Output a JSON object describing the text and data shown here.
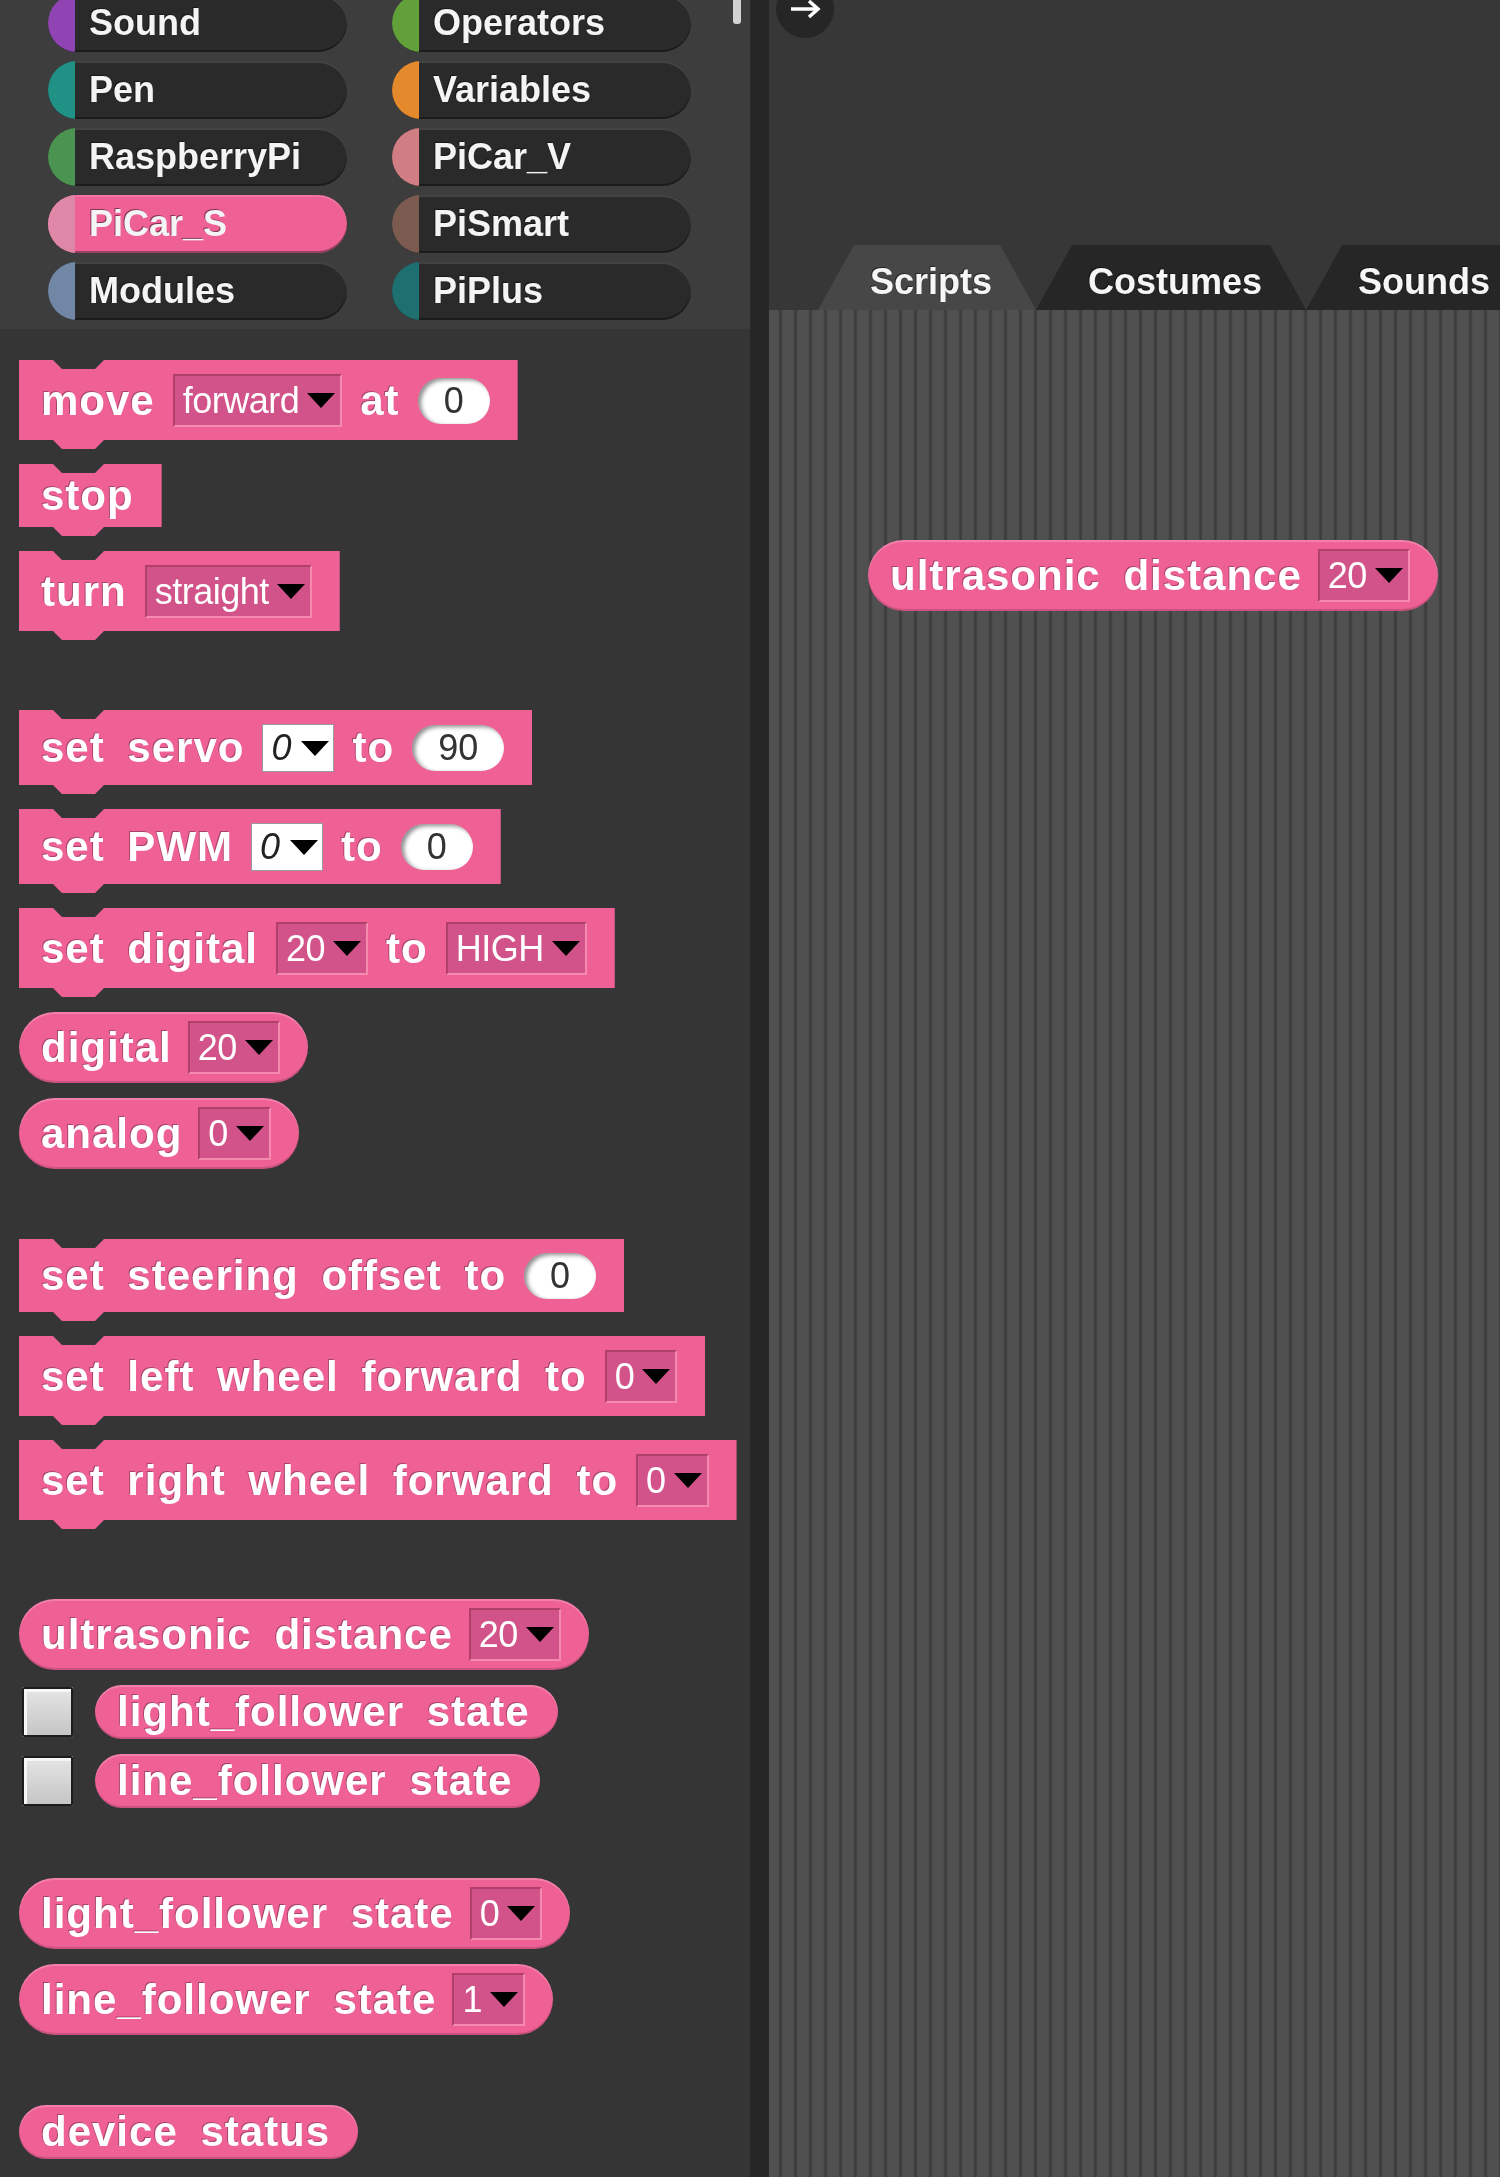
{
  "categories": [
    {
      "label": "Sound",
      "color": "#9044b4",
      "selected": false
    },
    {
      "label": "Operators",
      "color": "#62a13a",
      "selected": false
    },
    {
      "label": "Pen",
      "color": "#1f9185",
      "selected": false
    },
    {
      "label": "Variables",
      "color": "#e58a2c",
      "selected": false
    },
    {
      "label": "RaspberryPi",
      "color": "#4a9350",
      "selected": false
    },
    {
      "label": "PiCar_V",
      "color": "#d07d84",
      "selected": false
    },
    {
      "label": "PiCar_S",
      "color": "#ef6195",
      "selected": true
    },
    {
      "label": "PiSmart",
      "color": "#7b5a50",
      "selected": false
    },
    {
      "label": "Modules",
      "color": "#7088a6",
      "selected": false
    },
    {
      "label": "PiPlus",
      "color": "#1e7070",
      "selected": false
    }
  ],
  "palette": {
    "groups": [
      [
        {
          "kind": "command",
          "parts": [
            {
              "kind": "label",
              "text": "move"
            },
            {
              "kind": "dropdown",
              "text": "forward"
            },
            {
              "kind": "label",
              "text": "at"
            },
            {
              "kind": "number",
              "text": "0"
            }
          ]
        },
        {
          "kind": "command",
          "parts": [
            {
              "kind": "label",
              "text": "stop"
            }
          ]
        },
        {
          "kind": "command",
          "parts": [
            {
              "kind": "label",
              "text": "turn"
            },
            {
              "kind": "dropdown",
              "text": "straight"
            }
          ]
        }
      ],
      [
        {
          "kind": "command",
          "parts": [
            {
              "kind": "label",
              "text": "set servo"
            },
            {
              "kind": "editable",
              "text": "0"
            },
            {
              "kind": "label",
              "text": "to"
            },
            {
              "kind": "number",
              "text": "90"
            }
          ]
        },
        {
          "kind": "command",
          "parts": [
            {
              "kind": "label",
              "text": "set PWM"
            },
            {
              "kind": "editable",
              "text": "0"
            },
            {
              "kind": "label",
              "text": "to"
            },
            {
              "kind": "number",
              "text": "0"
            }
          ]
        },
        {
          "kind": "command",
          "parts": [
            {
              "kind": "label",
              "text": "set digital"
            },
            {
              "kind": "dropdown",
              "text": "20"
            },
            {
              "kind": "label",
              "text": "to"
            },
            {
              "kind": "dropdown",
              "text": "HIGH"
            }
          ]
        },
        {
          "kind": "reporter",
          "parts": [
            {
              "kind": "label",
              "text": "digital"
            },
            {
              "kind": "dropdown",
              "text": "20"
            }
          ]
        },
        {
          "kind": "reporter",
          "parts": [
            {
              "kind": "label",
              "text": "analog"
            },
            {
              "kind": "dropdown",
              "text": "0"
            }
          ]
        }
      ],
      [
        {
          "kind": "command",
          "parts": [
            {
              "kind": "label",
              "text": "set steering offset to"
            },
            {
              "kind": "number",
              "text": "0"
            }
          ]
        },
        {
          "kind": "command",
          "parts": [
            {
              "kind": "label",
              "text": "set left wheel forward to"
            },
            {
              "kind": "dropdown",
              "text": "0"
            }
          ]
        },
        {
          "kind": "command",
          "parts": [
            {
              "kind": "label",
              "text": "set right wheel forward to"
            },
            {
              "kind": "dropdown",
              "text": "0"
            }
          ]
        }
      ],
      [
        {
          "kind": "reporter",
          "parts": [
            {
              "kind": "label",
              "text": "ultrasonic distance"
            },
            {
              "kind": "dropdown",
              "text": "20"
            }
          ]
        },
        {
          "kind": "reporter",
          "watcher": {
            "checked": false
          },
          "parts": [
            {
              "kind": "label",
              "text": "light_follower state"
            }
          ]
        },
        {
          "kind": "reporter",
          "watcher": {
            "checked": false
          },
          "parts": [
            {
              "kind": "label",
              "text": "line_follower state"
            }
          ]
        }
      ],
      [
        {
          "kind": "reporter",
          "parts": [
            {
              "kind": "label",
              "text": "light_follower state"
            },
            {
              "kind": "dropdown",
              "text": "0"
            }
          ]
        },
        {
          "kind": "reporter",
          "parts": [
            {
              "kind": "label",
              "text": "line_follower state"
            },
            {
              "kind": "dropdown",
              "text": "1"
            }
          ]
        }
      ],
      [
        {
          "kind": "reporter",
          "parts": [
            {
              "kind": "label",
              "text": "device status"
            }
          ]
        }
      ]
    ]
  },
  "tabs": [
    {
      "label": "Scripts",
      "selected": true
    },
    {
      "label": "Costumes",
      "selected": false
    },
    {
      "label": "Sounds",
      "selected": false
    }
  ],
  "scripts": [
    {
      "kind": "reporter",
      "parts": [
        {
          "kind": "label",
          "text": "ultrasonic distance"
        },
        {
          "kind": "dropdown",
          "text": "20"
        }
      ]
    }
  ]
}
